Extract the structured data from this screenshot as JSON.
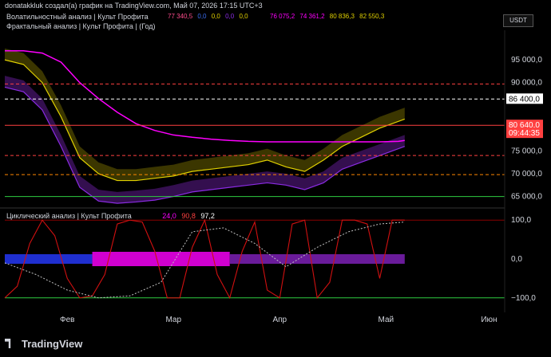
{
  "header": {
    "attribution": "donatakkluk создал(а) график на TradingView.com, Май 07, 2026 17:15 UTC+3",
    "indicator1": "Волатильностный анализ | Культ Профита",
    "indicator1_values": [
      "77 340,5",
      "0,0",
      "0,0",
      "0,0",
      "0,0",
      "76 075,2",
      "74 361,2",
      "80 836,3",
      "82 550,3"
    ],
    "indicator2": "Фрактальный анализ | Культ Профита | (Год)",
    "symbol_box": "USDT",
    "brand": "TradingView"
  },
  "lower_pane": {
    "label": "Циклический анализ | Культ Профита",
    "values": [
      "24,0",
      "90,8",
      "97,2"
    ]
  },
  "colors": {
    "background": "#000000",
    "price_line": "#ff4d8d",
    "yellow": "#e0d000",
    "magenta": "#ff00ff",
    "purple": "#8a2be2",
    "red_line": "#ff2020",
    "green": "#2ecc40"
  },
  "chart_data": [
    {
      "type": "line",
      "title": "Волатильностный анализ | Культ Профита",
      "y_axis": {
        "ticks": [
          95000,
          90000,
          75000,
          70000,
          65000
        ],
        "tick_labels": [
          "95 000,0",
          "90 000,0",
          "75 000,0",
          "70 000,0",
          "65 000,0"
        ],
        "ylim": [
          63000,
          101500
        ],
        "price_labels": [
          {
            "label": "86 400,0",
            "value": 86400
          },
          {
            "label": "80 640,0",
            "value": 80640
          },
          {
            "label": "09:44:35",
            "value": 78900
          }
        ]
      },
      "x_axis": {
        "tick_labels": [
          "Фев",
          "Мар",
          "Апр",
          "Май",
          "Июн"
        ],
        "xlim": [
          0,
          160
        ],
        "ticks": [
          20,
          54,
          88,
          122,
          155
        ]
      },
      "series": [
        {
          "role": "upper-mean-line",
          "x": [
            0,
            6,
            12,
            18,
            24,
            30,
            36,
            42,
            48,
            54,
            60,
            66,
            72,
            78,
            84,
            90,
            96,
            102,
            108,
            114,
            120,
            126,
            128
          ],
          "values": [
            97000,
            97000,
            96500,
            94500,
            90000,
            86500,
            83500,
            81000,
            79500,
            78500,
            78000,
            77600,
            77300,
            77100,
            77000,
            77000,
            77000,
            77000,
            77000,
            77000,
            77000,
            77100,
            77300
          ]
        },
        {
          "role": "center-band",
          "x": [
            0,
            6,
            12,
            18,
            24,
            30,
            36,
            42,
            48,
            54,
            60,
            66,
            72,
            78,
            84,
            90,
            96,
            102,
            108,
            114,
            120,
            126,
            128
          ],
          "values": [
            95000,
            94000,
            90000,
            82500,
            73500,
            70000,
            68500,
            68500,
            69000,
            69500,
            70500,
            71000,
            71500,
            72000,
            73000,
            71500,
            70500,
            73000,
            76000,
            78000,
            80000,
            81500,
            82000
          ]
        },
        {
          "role": "lower-band",
          "x": [
            0,
            6,
            12,
            18,
            24,
            30,
            36,
            42,
            48,
            54,
            60,
            66,
            72,
            78,
            84,
            90,
            96,
            102,
            108,
            114,
            120,
            126,
            128
          ],
          "values": [
            89000,
            88000,
            84000,
            76000,
            67000,
            64000,
            63500,
            63800,
            64200,
            65000,
            66000,
            66500,
            67000,
            67500,
            68000,
            67500,
            66500,
            68000,
            71000,
            72500,
            74000,
            75500,
            76000
          ]
        }
      ],
      "levels": [
        {
          "value": 86400,
          "style": "dashed",
          "color": "#ffffff"
        },
        {
          "value": 80640,
          "style": "solid",
          "color": "#ff4040"
        },
        {
          "value": 74000,
          "style": "dashed",
          "color": "#ff4040"
        },
        {
          "value": 89700,
          "style": "dashed",
          "color": "#ff4040"
        },
        {
          "value": 69800,
          "style": "dashed",
          "color": "#ff8800"
        },
        {
          "value": 65000,
          "style": "solid",
          "color": "#2ecc40"
        }
      ]
    },
    {
      "type": "line",
      "title": "Циклический анализ | Культ Профита",
      "y_axis": {
        "ticks": [
          100,
          0,
          -100
        ],
        "tick_labels": [
          "100,0",
          "0,0",
          "−100,0"
        ],
        "ylim": [
          -125,
          125
        ]
      },
      "series": [
        {
          "role": "cycle-oscillator",
          "x": [
            0,
            4,
            8,
            12,
            16,
            20,
            24,
            28,
            32,
            36,
            40,
            44,
            48,
            52,
            56,
            60,
            64,
            68,
            72,
            76,
            80,
            84,
            88,
            92,
            96,
            100,
            104,
            108,
            112,
            116,
            120,
            124,
            128
          ],
          "values": [
            -100,
            -70,
            40,
            100,
            60,
            -50,
            -100,
            -95,
            -40,
            90,
            100,
            95,
            20,
            -100,
            -100,
            30,
            100,
            -40,
            -100,
            20,
            95,
            -80,
            -100,
            90,
            100,
            -100,
            -60,
            100,
            100,
            90,
            -50,
            100,
            100
          ]
        },
        {
          "role": "trend-dotted",
          "x": [
            0,
            10,
            20,
            30,
            40,
            50,
            60,
            70,
            80,
            90,
            100,
            110,
            120,
            128
          ],
          "values": [
            -10,
            -40,
            -80,
            -100,
            -95,
            -60,
            70,
            80,
            40,
            -20,
            30,
            70,
            90,
            95
          ]
        }
      ]
    }
  ]
}
